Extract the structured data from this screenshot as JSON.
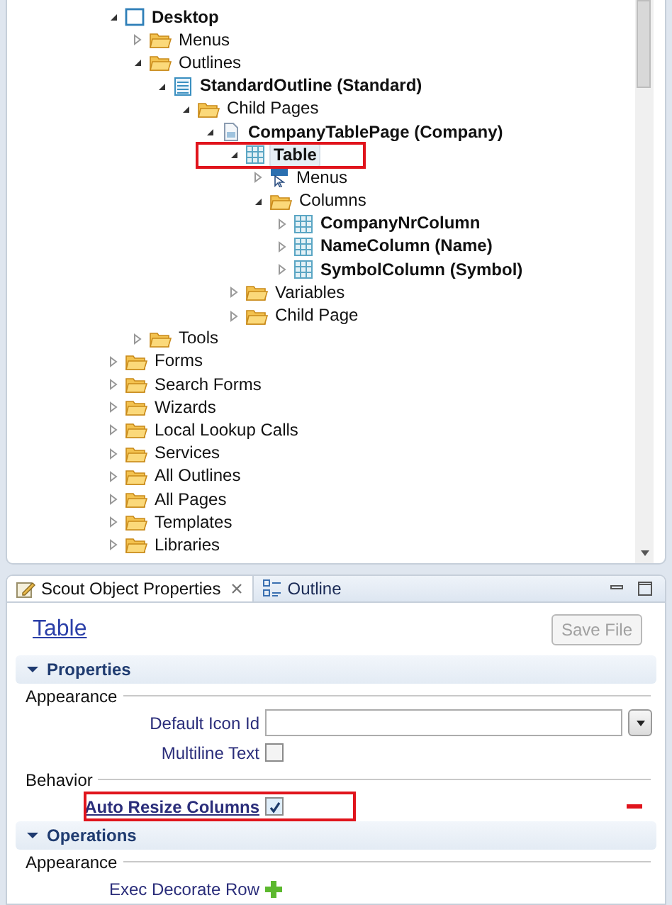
{
  "tree": [
    {
      "label": "Desktop",
      "kind": "desktop",
      "expanded": true,
      "selected": false,
      "highlighted": false,
      "children": [
        {
          "label": "Menus",
          "kind": "folder",
          "expanded": false,
          "selected": false,
          "highlighted": false
        },
        {
          "label": "Outlines",
          "kind": "folder",
          "expanded": true,
          "selected": false,
          "highlighted": false,
          "children": [
            {
              "label": "StandardOutline (Standard)",
              "kind": "outline",
              "expanded": true,
              "selected": false,
              "highlighted": false,
              "children": [
                {
                  "label": "Child Pages",
                  "kind": "folder",
                  "expanded": true,
                  "selected": false,
                  "highlighted": false,
                  "children": [
                    {
                      "label": "CompanyTablePage (Company)",
                      "kind": "page",
                      "expanded": true,
                      "selected": false,
                      "highlighted": false,
                      "children": [
                        {
                          "label": "Table",
                          "kind": "table",
                          "expanded": true,
                          "selected": true,
                          "highlighted": true,
                          "children": [
                            {
                              "label": "Menus",
                              "kind": "menu",
                              "expanded": false,
                              "selected": false,
                              "highlighted": false
                            },
                            {
                              "label": "Columns",
                              "kind": "folder",
                              "expanded": true,
                              "selected": false,
                              "highlighted": false,
                              "children": [
                                {
                                  "label": "CompanyNrColumn",
                                  "kind": "column",
                                  "expanded": false,
                                  "selected": false,
                                  "highlighted": false
                                },
                                {
                                  "label": "NameColumn (Name)",
                                  "kind": "column",
                                  "expanded": false,
                                  "selected": false,
                                  "highlighted": false
                                },
                                {
                                  "label": "SymbolColumn (Symbol)",
                                  "kind": "column",
                                  "expanded": false,
                                  "selected": false,
                                  "highlighted": false
                                }
                              ]
                            }
                          ]
                        },
                        {
                          "label": "Variables",
                          "kind": "folder",
                          "expanded": false,
                          "selected": false,
                          "highlighted": false
                        },
                        {
                          "label": "Child Page",
                          "kind": "folder",
                          "expanded": false,
                          "selected": false,
                          "highlighted": false
                        }
                      ]
                    }
                  ]
                }
              ]
            }
          ]
        },
        {
          "label": "Tools",
          "kind": "folder",
          "expanded": false,
          "selected": false,
          "highlighted": false
        }
      ]
    },
    {
      "label": "Forms",
      "kind": "folder",
      "expanded": false,
      "selected": false,
      "highlighted": false
    },
    {
      "label": "Search Forms",
      "kind": "folder",
      "expanded": false,
      "selected": false,
      "highlighted": false
    },
    {
      "label": "Wizards",
      "kind": "folder",
      "expanded": false,
      "selected": false,
      "highlighted": false
    },
    {
      "label": "Local Lookup Calls",
      "kind": "folder",
      "expanded": false,
      "selected": false,
      "highlighted": false
    },
    {
      "label": "Services",
      "kind": "folder",
      "expanded": false,
      "selected": false,
      "highlighted": false
    },
    {
      "label": "All Outlines",
      "kind": "folder",
      "expanded": false,
      "selected": false,
      "highlighted": false
    },
    {
      "label": "All Pages",
      "kind": "folder",
      "expanded": false,
      "selected": false,
      "highlighted": false
    },
    {
      "label": "Templates",
      "kind": "folder",
      "expanded": false,
      "selected": false,
      "highlighted": false
    },
    {
      "label": "Libraries",
      "kind": "folder",
      "expanded": false,
      "selected": false,
      "highlighted": false
    }
  ],
  "tabs": [
    {
      "label": "Scout Object Properties",
      "selected": true
    },
    {
      "label": "Outline",
      "selected": false
    }
  ],
  "object_title": "Table",
  "save_button": {
    "label": "Save File",
    "disabled": true
  },
  "sections": [
    {
      "title": "Properties",
      "expanded": true,
      "groups": [
        {
          "title": "Appearance",
          "fields": [
            {
              "kind": "combo",
              "label": "Default Icon Id",
              "modified": false,
              "highlighted": false
            },
            {
              "kind": "checkbox",
              "label": "Multiline Text",
              "checked": false,
              "modified": false,
              "highlighted": false
            }
          ]
        },
        {
          "title": "Behavior",
          "fields": [
            {
              "kind": "checkbox",
              "label": "Auto Resize Columns",
              "checked": true,
              "modified": true,
              "highlighted": true
            }
          ]
        }
      ]
    },
    {
      "title": "Operations",
      "expanded": true,
      "groups": [
        {
          "title": "Appearance",
          "fields": [
            {
              "kind": "operation",
              "label": "Exec Decorate Row",
              "modified": false,
              "highlighted": false
            }
          ]
        }
      ]
    }
  ]
}
